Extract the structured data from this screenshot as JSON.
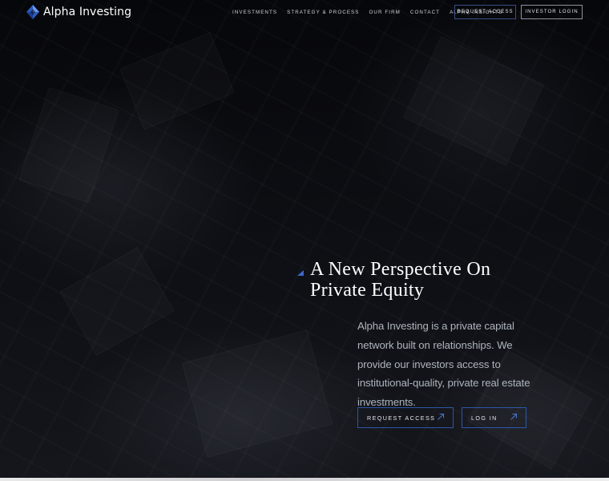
{
  "brand": {
    "name": "Alpha Investing",
    "logo_icon": "diamond-logo-icon"
  },
  "nav": {
    "items": [
      {
        "label": "INVESTMENTS"
      },
      {
        "label": "STRATEGY & PROCESS"
      },
      {
        "label": "OUR FIRM"
      },
      {
        "label": "CONTACT"
      },
      {
        "label": "ALPHA INSIGHTS"
      }
    ],
    "request_access": "REQUEST ACCESS",
    "investor_login": "INVESTOR LOGIN"
  },
  "hero": {
    "headline_line1": "A New Perspective On",
    "headline_line2": "Private Equity",
    "description": "Alpha Investing is a private capital network built on relationships. We provide our investors access to institutional-quality, private real estate investments.",
    "cta_request": "REQUEST ACCESS",
    "cta_login": "LOG IN",
    "arrow_icon": "arrow-up-right-icon"
  },
  "colors": {
    "accent_blue": "#3f66c8",
    "button_border": "#2e56a8",
    "background": "#0b0c10"
  }
}
